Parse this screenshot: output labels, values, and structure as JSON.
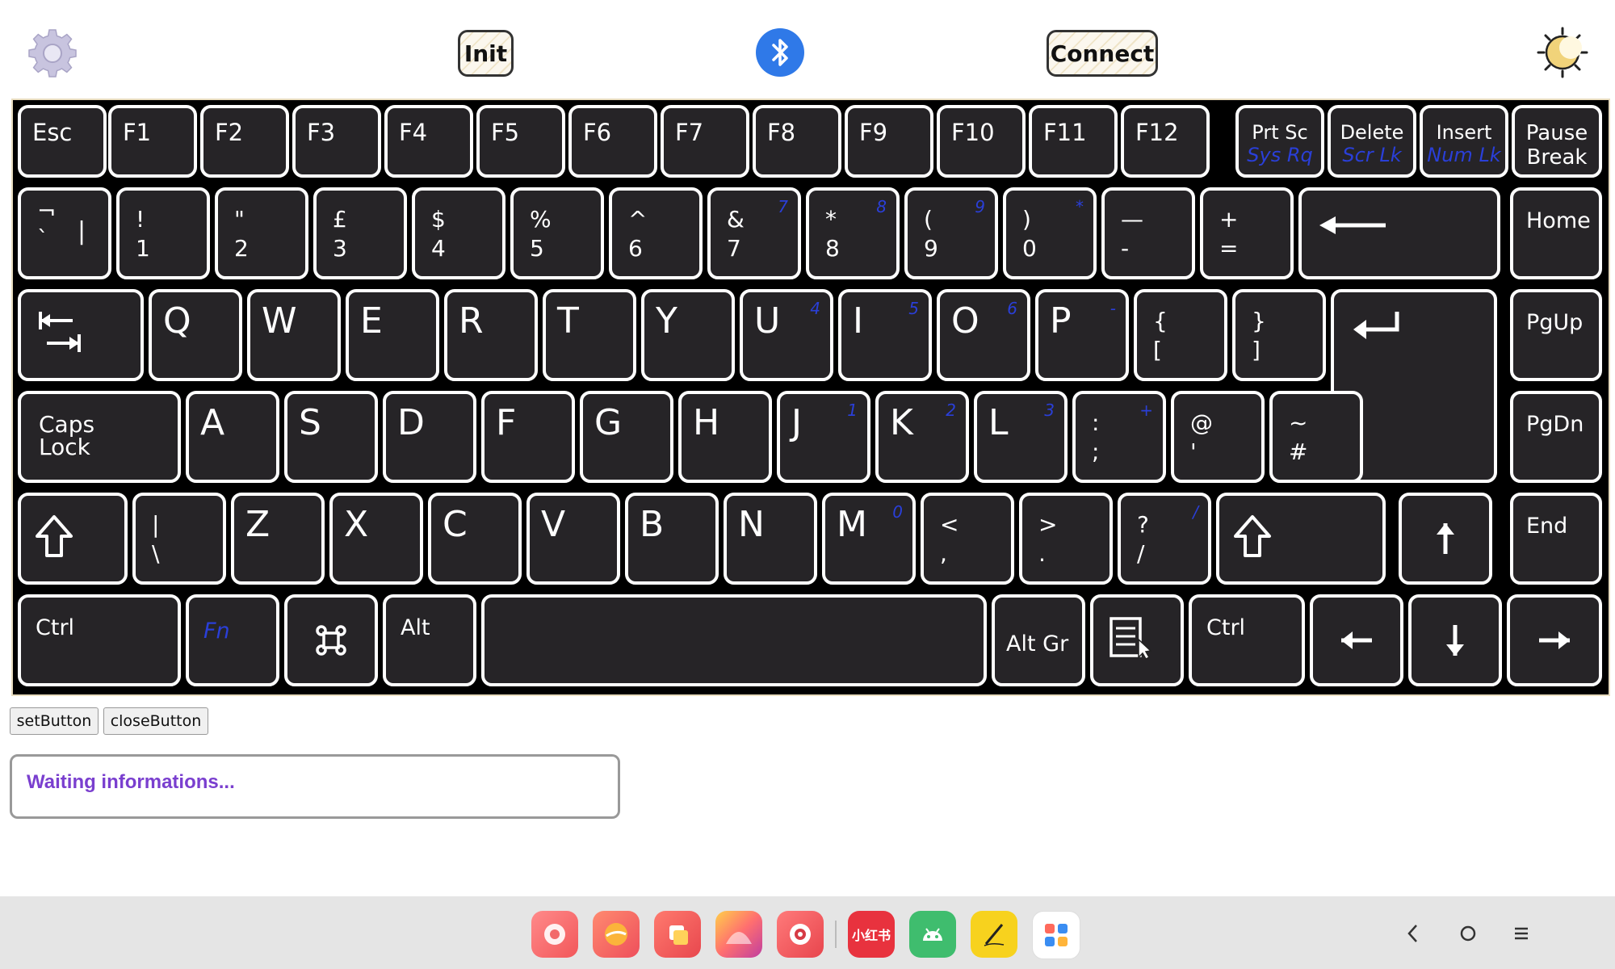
{
  "top_bar": {
    "init_label": "Init",
    "connect_label": "Connect",
    "icons": [
      "gear-icon",
      "bluetooth-icon",
      "sun-moon-icon"
    ]
  },
  "keyboard": {
    "rows": [
      [
        {
          "name": "esc",
          "labels": [
            "Esc"
          ]
        },
        {
          "name": "f1",
          "labels": [
            "F1"
          ]
        },
        {
          "name": "f2",
          "labels": [
            "F2"
          ]
        },
        {
          "name": "f3",
          "labels": [
            "F3"
          ]
        },
        {
          "name": "f4",
          "labels": [
            "F4"
          ]
        },
        {
          "name": "f5",
          "labels": [
            "F5"
          ]
        },
        {
          "name": "f6",
          "labels": [
            "F6"
          ]
        },
        {
          "name": "f7",
          "labels": [
            "F7"
          ]
        },
        {
          "name": "f8",
          "labels": [
            "F8"
          ]
        },
        {
          "name": "f9",
          "labels": [
            "F9"
          ]
        },
        {
          "name": "f10",
          "labels": [
            "F10"
          ]
        },
        {
          "name": "f11",
          "labels": [
            "F11"
          ]
        },
        {
          "name": "f12",
          "labels": [
            "F12"
          ]
        },
        {
          "name": "prtsc",
          "labels": [
            "Prt Sc",
            "Sys Rq"
          ]
        },
        {
          "name": "delete",
          "labels": [
            "Delete",
            "Scr Lk"
          ]
        },
        {
          "name": "insert",
          "labels": [
            "Insert",
            "Num Lk"
          ]
        },
        {
          "name": "pause",
          "labels": [
            "Pause",
            "Break"
          ]
        }
      ],
      [
        {
          "name": "backtick",
          "labels": [
            "¬",
            "`",
            "|"
          ]
        },
        {
          "name": "1",
          "labels": [
            "!",
            "1"
          ]
        },
        {
          "name": "2",
          "labels": [
            "\"",
            "2"
          ]
        },
        {
          "name": "3",
          "labels": [
            "£",
            "3"
          ]
        },
        {
          "name": "4",
          "labels": [
            "$",
            "4"
          ]
        },
        {
          "name": "5",
          "labels": [
            "%",
            "5"
          ]
        },
        {
          "name": "6",
          "labels": [
            "^",
            "6"
          ]
        },
        {
          "name": "7",
          "labels": [
            "&",
            "7",
            "7"
          ]
        },
        {
          "name": "8",
          "labels": [
            "*",
            "8",
            "8"
          ]
        },
        {
          "name": "9",
          "labels": [
            "(",
            "9",
            "9"
          ]
        },
        {
          "name": "0",
          "labels": [
            ")",
            "0",
            "*"
          ]
        },
        {
          "name": "minus",
          "labels": [
            "—",
            "-"
          ]
        },
        {
          "name": "equals",
          "labels": [
            "+",
            "="
          ]
        },
        {
          "name": "backspace",
          "labels": []
        },
        {
          "name": "home",
          "labels": [
            "Home"
          ]
        }
      ],
      [
        {
          "name": "tab",
          "labels": []
        },
        {
          "name": "q",
          "labels": [
            "Q"
          ]
        },
        {
          "name": "w",
          "labels": [
            "W"
          ]
        },
        {
          "name": "e",
          "labels": [
            "E"
          ]
        },
        {
          "name": "r",
          "labels": [
            "R"
          ]
        },
        {
          "name": "t",
          "labels": [
            "T"
          ]
        },
        {
          "name": "y",
          "labels": [
            "Y"
          ]
        },
        {
          "name": "u",
          "labels": [
            "U",
            "4"
          ]
        },
        {
          "name": "i",
          "labels": [
            "I",
            "5"
          ]
        },
        {
          "name": "o",
          "labels": [
            "O",
            "6"
          ]
        },
        {
          "name": "p",
          "labels": [
            "P",
            "-"
          ]
        },
        {
          "name": "lbracket",
          "labels": [
            "{",
            "["
          ]
        },
        {
          "name": "rbracket",
          "labels": [
            "}",
            "]"
          ]
        },
        {
          "name": "enter",
          "labels": []
        },
        {
          "name": "pgup",
          "labels": [
            "PgUp"
          ]
        }
      ],
      [
        {
          "name": "capslock",
          "labels": [
            "Caps",
            "Lock"
          ]
        },
        {
          "name": "a",
          "labels": [
            "A"
          ]
        },
        {
          "name": "s",
          "labels": [
            "S"
          ]
        },
        {
          "name": "d",
          "labels": [
            "D"
          ]
        },
        {
          "name": "f",
          "labels": [
            "F"
          ]
        },
        {
          "name": "g",
          "labels": [
            "G"
          ]
        },
        {
          "name": "h",
          "labels": [
            "H"
          ]
        },
        {
          "name": "j",
          "labels": [
            "J",
            "1"
          ]
        },
        {
          "name": "k",
          "labels": [
            "K",
            "2"
          ]
        },
        {
          "name": "l",
          "labels": [
            "L",
            "3"
          ]
        },
        {
          "name": "semicolon",
          "labels": [
            ":",
            ";",
            "+"
          ]
        },
        {
          "name": "quote",
          "labels": [
            "@",
            "'"
          ]
        },
        {
          "name": "hash",
          "labels": [
            "~",
            "#"
          ]
        },
        {
          "name": "pgdn",
          "labels": [
            "PgDn"
          ]
        }
      ],
      [
        {
          "name": "lshift",
          "labels": []
        },
        {
          "name": "backslash",
          "labels": [
            "|",
            "\\"
          ]
        },
        {
          "name": "z",
          "labels": [
            "Z"
          ]
        },
        {
          "name": "x",
          "labels": [
            "X"
          ]
        },
        {
          "name": "c",
          "labels": [
            "C"
          ]
        },
        {
          "name": "v",
          "labels": [
            "V"
          ]
        },
        {
          "name": "b",
          "labels": [
            "B"
          ]
        },
        {
          "name": "n",
          "labels": [
            "N"
          ]
        },
        {
          "name": "m",
          "labels": [
            "M",
            "0"
          ]
        },
        {
          "name": "comma",
          "labels": [
            "<",
            ","
          ]
        },
        {
          "name": "period",
          "labels": [
            ">",
            "."
          ]
        },
        {
          "name": "slash",
          "labels": [
            "?",
            "/",
            "/"
          ]
        },
        {
          "name": "rshift",
          "labels": []
        },
        {
          "name": "up",
          "labels": []
        },
        {
          "name": "end",
          "labels": [
            "End"
          ]
        }
      ],
      [
        {
          "name": "lctrl",
          "labels": [
            "Ctrl"
          ]
        },
        {
          "name": "fn",
          "labels": [
            "Fn"
          ]
        },
        {
          "name": "command",
          "labels": []
        },
        {
          "name": "alt",
          "labels": [
            "Alt"
          ]
        },
        {
          "name": "space",
          "labels": []
        },
        {
          "name": "altgr",
          "labels": [
            "Alt Gr"
          ]
        },
        {
          "name": "menu",
          "labels": []
        },
        {
          "name": "rctrl",
          "labels": [
            "Ctrl"
          ]
        },
        {
          "name": "left",
          "labels": []
        },
        {
          "name": "down",
          "labels": []
        },
        {
          "name": "right",
          "labels": []
        }
      ]
    ]
  },
  "controls": {
    "set_label": "setButton",
    "close_label": "closeButton"
  },
  "info": {
    "text": "Waiting informations..."
  },
  "taskbar": {
    "apps": [
      {
        "name": "settings-app-icon"
      },
      {
        "name": "browser-app-icon"
      },
      {
        "name": "files-app-icon"
      },
      {
        "name": "gallery-app-icon"
      },
      {
        "name": "camera-app-icon"
      },
      {
        "name": "xiaohongshu-app-icon",
        "label": "小红书"
      },
      {
        "name": "android-app-icon"
      },
      {
        "name": "notes-app-icon"
      },
      {
        "name": "app-drawer-icon"
      }
    ],
    "nav": [
      "back-icon",
      "home-icon",
      "menu-icon"
    ]
  }
}
